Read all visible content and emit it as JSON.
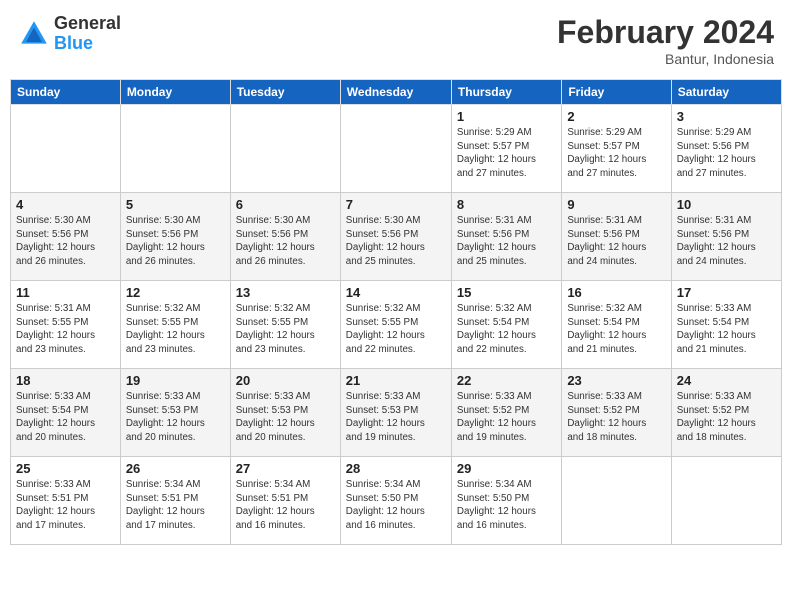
{
  "header": {
    "logo_general": "General",
    "logo_blue": "Blue",
    "month_title": "February 2024",
    "subtitle": "Bantur, Indonesia"
  },
  "columns": [
    "Sunday",
    "Monday",
    "Tuesday",
    "Wednesday",
    "Thursday",
    "Friday",
    "Saturday"
  ],
  "weeks": [
    {
      "days": [
        {
          "num": "",
          "info": ""
        },
        {
          "num": "",
          "info": ""
        },
        {
          "num": "",
          "info": ""
        },
        {
          "num": "",
          "info": ""
        },
        {
          "num": "1",
          "info": "Sunrise: 5:29 AM\nSunset: 5:57 PM\nDaylight: 12 hours\nand 27 minutes."
        },
        {
          "num": "2",
          "info": "Sunrise: 5:29 AM\nSunset: 5:57 PM\nDaylight: 12 hours\nand 27 minutes."
        },
        {
          "num": "3",
          "info": "Sunrise: 5:29 AM\nSunset: 5:56 PM\nDaylight: 12 hours\nand 27 minutes."
        }
      ]
    },
    {
      "days": [
        {
          "num": "4",
          "info": "Sunrise: 5:30 AM\nSunset: 5:56 PM\nDaylight: 12 hours\nand 26 minutes."
        },
        {
          "num": "5",
          "info": "Sunrise: 5:30 AM\nSunset: 5:56 PM\nDaylight: 12 hours\nand 26 minutes."
        },
        {
          "num": "6",
          "info": "Sunrise: 5:30 AM\nSunset: 5:56 PM\nDaylight: 12 hours\nand 26 minutes."
        },
        {
          "num": "7",
          "info": "Sunrise: 5:30 AM\nSunset: 5:56 PM\nDaylight: 12 hours\nand 25 minutes."
        },
        {
          "num": "8",
          "info": "Sunrise: 5:31 AM\nSunset: 5:56 PM\nDaylight: 12 hours\nand 25 minutes."
        },
        {
          "num": "9",
          "info": "Sunrise: 5:31 AM\nSunset: 5:56 PM\nDaylight: 12 hours\nand 24 minutes."
        },
        {
          "num": "10",
          "info": "Sunrise: 5:31 AM\nSunset: 5:56 PM\nDaylight: 12 hours\nand 24 minutes."
        }
      ]
    },
    {
      "days": [
        {
          "num": "11",
          "info": "Sunrise: 5:31 AM\nSunset: 5:55 PM\nDaylight: 12 hours\nand 23 minutes."
        },
        {
          "num": "12",
          "info": "Sunrise: 5:32 AM\nSunset: 5:55 PM\nDaylight: 12 hours\nand 23 minutes."
        },
        {
          "num": "13",
          "info": "Sunrise: 5:32 AM\nSunset: 5:55 PM\nDaylight: 12 hours\nand 23 minutes."
        },
        {
          "num": "14",
          "info": "Sunrise: 5:32 AM\nSunset: 5:55 PM\nDaylight: 12 hours\nand 22 minutes."
        },
        {
          "num": "15",
          "info": "Sunrise: 5:32 AM\nSunset: 5:54 PM\nDaylight: 12 hours\nand 22 minutes."
        },
        {
          "num": "16",
          "info": "Sunrise: 5:32 AM\nSunset: 5:54 PM\nDaylight: 12 hours\nand 21 minutes."
        },
        {
          "num": "17",
          "info": "Sunrise: 5:33 AM\nSunset: 5:54 PM\nDaylight: 12 hours\nand 21 minutes."
        }
      ]
    },
    {
      "days": [
        {
          "num": "18",
          "info": "Sunrise: 5:33 AM\nSunset: 5:54 PM\nDaylight: 12 hours\nand 20 minutes."
        },
        {
          "num": "19",
          "info": "Sunrise: 5:33 AM\nSunset: 5:53 PM\nDaylight: 12 hours\nand 20 minutes."
        },
        {
          "num": "20",
          "info": "Sunrise: 5:33 AM\nSunset: 5:53 PM\nDaylight: 12 hours\nand 20 minutes."
        },
        {
          "num": "21",
          "info": "Sunrise: 5:33 AM\nSunset: 5:53 PM\nDaylight: 12 hours\nand 19 minutes."
        },
        {
          "num": "22",
          "info": "Sunrise: 5:33 AM\nSunset: 5:52 PM\nDaylight: 12 hours\nand 19 minutes."
        },
        {
          "num": "23",
          "info": "Sunrise: 5:33 AM\nSunset: 5:52 PM\nDaylight: 12 hours\nand 18 minutes."
        },
        {
          "num": "24",
          "info": "Sunrise: 5:33 AM\nSunset: 5:52 PM\nDaylight: 12 hours\nand 18 minutes."
        }
      ]
    },
    {
      "days": [
        {
          "num": "25",
          "info": "Sunrise: 5:33 AM\nSunset: 5:51 PM\nDaylight: 12 hours\nand 17 minutes."
        },
        {
          "num": "26",
          "info": "Sunrise: 5:34 AM\nSunset: 5:51 PM\nDaylight: 12 hours\nand 17 minutes."
        },
        {
          "num": "27",
          "info": "Sunrise: 5:34 AM\nSunset: 5:51 PM\nDaylight: 12 hours\nand 16 minutes."
        },
        {
          "num": "28",
          "info": "Sunrise: 5:34 AM\nSunset: 5:50 PM\nDaylight: 12 hours\nand 16 minutes."
        },
        {
          "num": "29",
          "info": "Sunrise: 5:34 AM\nSunset: 5:50 PM\nDaylight: 12 hours\nand 16 minutes."
        },
        {
          "num": "",
          "info": ""
        },
        {
          "num": "",
          "info": ""
        }
      ]
    }
  ]
}
